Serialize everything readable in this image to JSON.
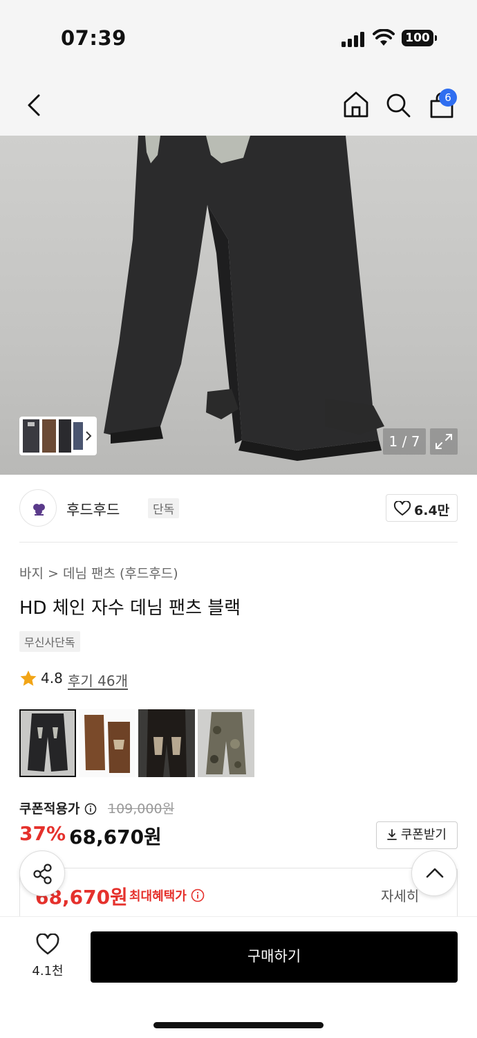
{
  "status_bar": {
    "time": "07:39",
    "battery": "100"
  },
  "nav": {
    "cart_count": "6"
  },
  "gallery": {
    "counter": "1 / 7"
  },
  "brand": {
    "name": "후드후드",
    "tag": "단독",
    "likes": "6.4만"
  },
  "product": {
    "breadcrumb": "바지 > 데님 팬츠 (후드후드)",
    "title": "HD 체인 자수 데님 팬츠 블랙",
    "tag": "무신사단독",
    "rating": "4.8",
    "reviews": "후기 46개"
  },
  "price": {
    "coupon_label": "쿠폰적용가",
    "original": "109,000원",
    "discount": "37%",
    "sale": "68,670원",
    "coupon_button": "쿠폰받기"
  },
  "benefit": {
    "price": "68,670원",
    "label": "최대혜택가",
    "detail": "자세히"
  },
  "bottom": {
    "wish_count": "4.1천",
    "buy_label": "구매하기"
  },
  "colors": {
    "accent_red": "#e5312c",
    "badge_blue": "#2f6ef0",
    "buy_black": "#000000"
  },
  "icons": [
    "back-icon",
    "home-icon",
    "search-icon",
    "cart-icon",
    "expand-icon",
    "heart-icon",
    "star-icon",
    "info-icon",
    "download-icon",
    "share-icon",
    "chevron-up-icon"
  ]
}
